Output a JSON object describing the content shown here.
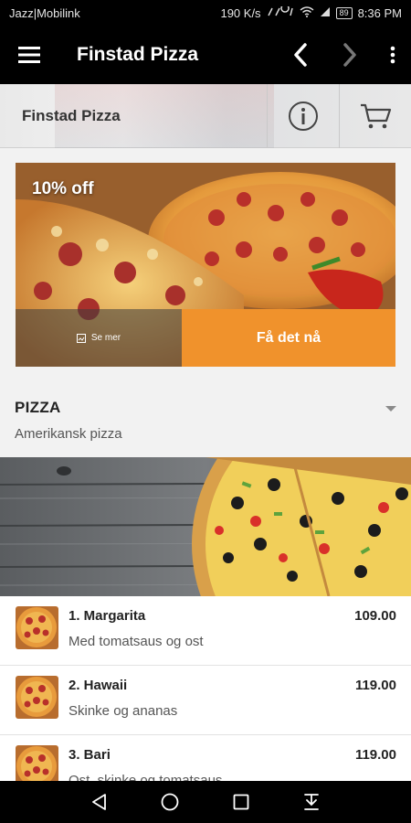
{
  "status_bar": {
    "carrier": "Jazz|Mobilink",
    "speed": "190 K/s",
    "battery": "89",
    "time": "8:36 PM"
  },
  "app_bar": {
    "title": "Finstad Pizza",
    "icons": [
      "menu-icon",
      "chevron-left-icon",
      "chevron-right-icon",
      "more-vert-icon"
    ]
  },
  "store_header": {
    "name": "Finstad Pizza",
    "icons": [
      "info-icon",
      "cart-icon"
    ]
  },
  "promo": {
    "badge": "10% off",
    "see_more": "Se mer",
    "cta": "Få det nå",
    "colors": {
      "cta": "#f0922c"
    }
  },
  "category": {
    "title": "PIZZA",
    "subtitle": "Amerikansk pizza"
  },
  "menu_items": [
    {
      "name": "1. Margarita",
      "description": "Med tomatsaus og ost",
      "price": "109.00"
    },
    {
      "name": "2. Hawaii",
      "description": "Skinke og ananas",
      "price": "119.00"
    },
    {
      "name": "3. Bari",
      "description": "Ost, skinke og tomatsaus",
      "price": "119.00"
    }
  ],
  "system_nav": {
    "icons": [
      "back-icon",
      "home-icon",
      "recents-icon",
      "notification-pull-icon"
    ]
  }
}
